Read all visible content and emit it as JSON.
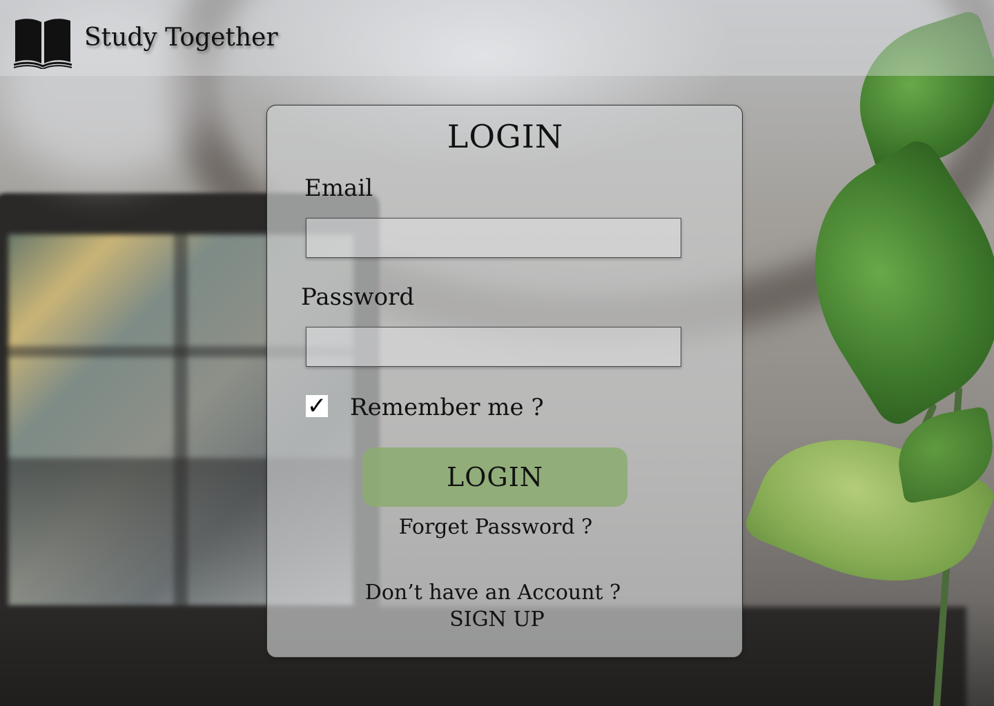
{
  "header": {
    "brand": "Study Together",
    "logo_icon": "open-book-icon"
  },
  "login_card": {
    "title": "LOGIN",
    "email_label": "Email",
    "email_value": "",
    "password_label": "Password",
    "password_value": "",
    "remember_checked": true,
    "remember_mark": "✓",
    "remember_label": "Remember me ?",
    "login_button": "LOGIN",
    "forgot_password": "Forget Password ?",
    "no_account": "Don’t have an Account ?",
    "sign_up": "SIGN UP"
  },
  "colors": {
    "login_button": "#8bac6e",
    "card_border": "#2e2e2e"
  }
}
